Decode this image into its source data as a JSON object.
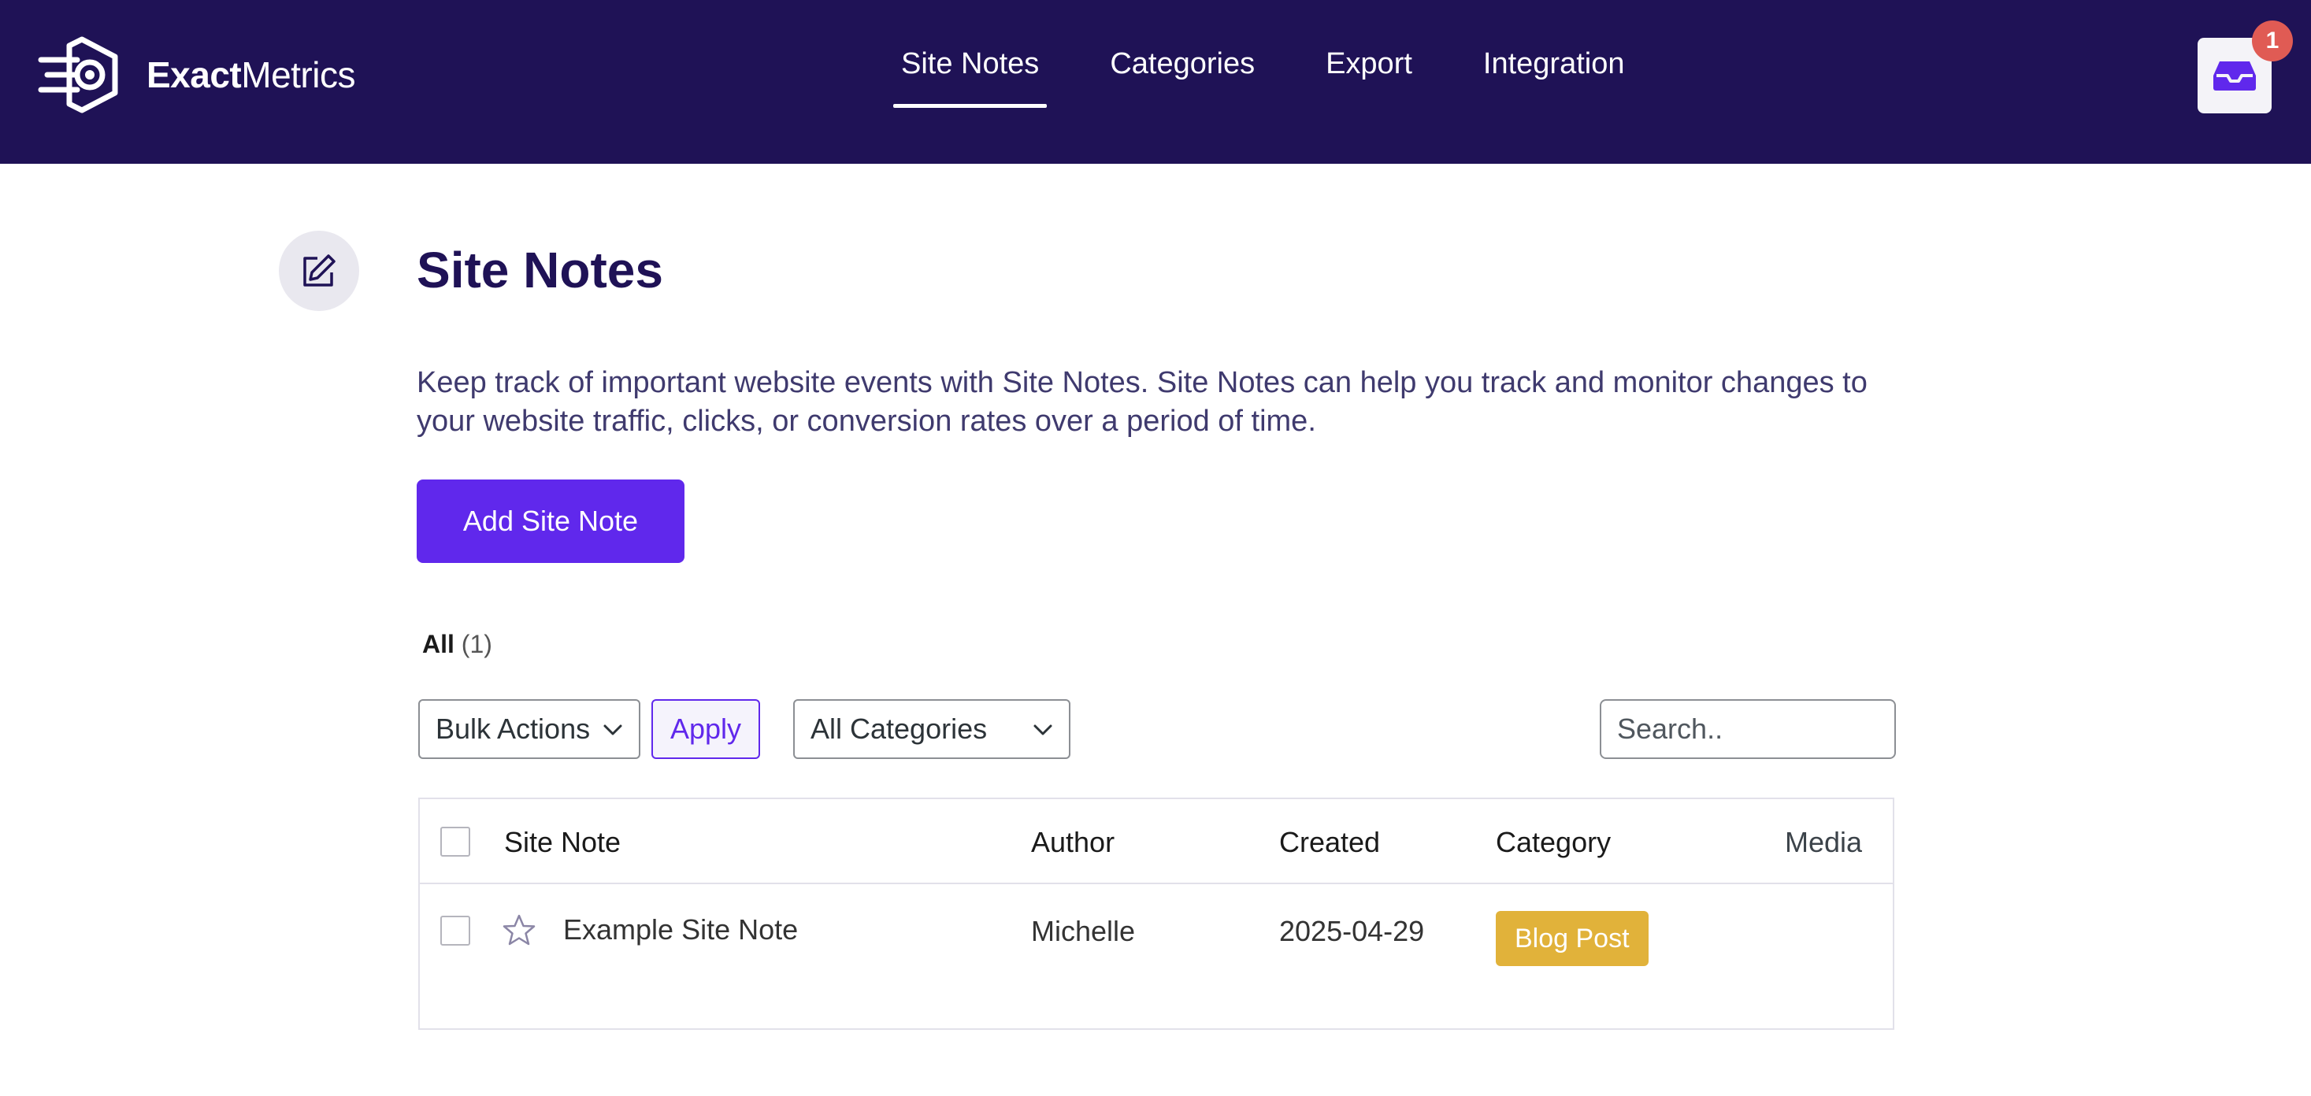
{
  "header": {
    "brand_bold": "Exact",
    "brand_light": "Metrics",
    "nav": [
      {
        "label": "Site Notes",
        "active": true
      },
      {
        "label": "Categories",
        "active": false
      },
      {
        "label": "Export",
        "active": false
      },
      {
        "label": "Integration",
        "active": false
      }
    ],
    "notifications_count": "1"
  },
  "page": {
    "title": "Site Notes",
    "description": "Keep track of important website events with Site Notes. Site Notes can help you track and monitor changes to your website traffic, clicks, or conversion rates over a period of time.",
    "add_button": "Add Site Note"
  },
  "filters": {
    "all_label": "All",
    "all_count": "(1)",
    "bulk_actions": "Bulk Actions",
    "apply": "Apply",
    "categories": "All Categories",
    "search_placeholder": "Search.."
  },
  "table": {
    "columns": [
      "Site Note",
      "Author",
      "Created",
      "Category",
      "Media"
    ],
    "rows": [
      {
        "note": "Example Site Note",
        "author": "Michelle",
        "created": "2025-04-29",
        "category": "Blog Post",
        "media": ""
      }
    ]
  },
  "colors": {
    "header_bg": "#1f1256",
    "accent": "#6028ec",
    "badge": "#e05b54",
    "category_pill": "#e1b23a"
  }
}
